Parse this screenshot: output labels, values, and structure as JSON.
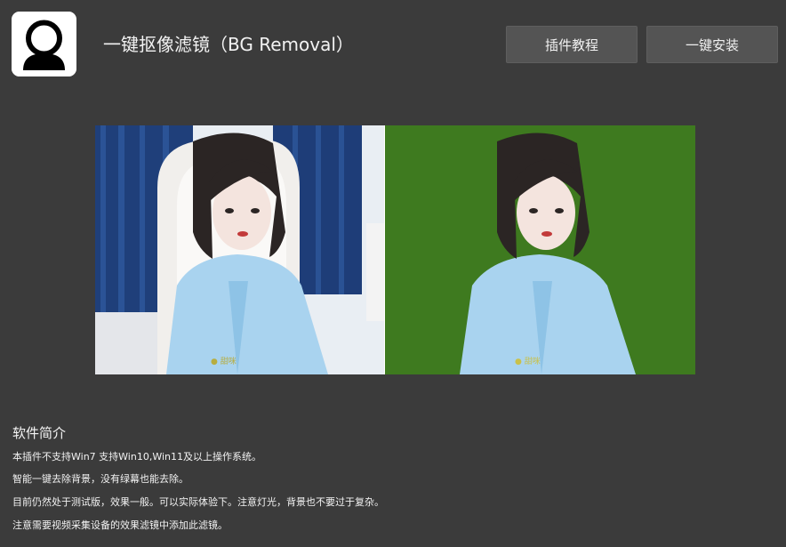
{
  "header": {
    "app_icon": "user-avatar-icon",
    "title": "一键抠像滤镜（BG Removal）",
    "tutorial_button": "插件教程",
    "install_button": "一键安装"
  },
  "preview": {
    "green_screen_color": "#3e7a1f"
  },
  "intro": {
    "title": "软件简介",
    "lines": [
      "本插件不支持Win7 支持Win10,Win11及以上操作系统。",
      "智能一键去除背景，没有绿幕也能去除。",
      "目前仍然处于测试版，效果一般。可以实际体验下。注意灯光，背景也不要过于复杂。",
      "注意需要视频采集设备的效果滤镜中添加此滤镜。"
    ]
  }
}
